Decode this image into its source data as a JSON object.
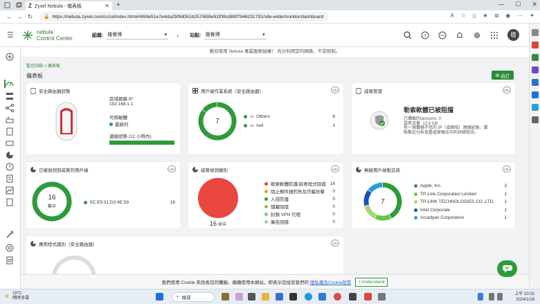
{
  "browser": {
    "tab_title": "Zyxel Nebula - 儀表板",
    "tab_favicon": "Z",
    "url": "https://nebula.zyxel.com/cc/ui/index.html#/659e51e7e4da25f9d051b257/659e51f09cd88f7946231791/site-wide/monitor/dashboard"
  },
  "header": {
    "logo_line1": "nebula",
    "logo_line2": "Control Center",
    "org_label": "組織:",
    "org_value": "雅餐博",
    "site_label": "站點:",
    "site_value": "雅餐博",
    "avatar_initial": "穩"
  },
  "banner": "歡迎使用 Nebula 專業服務授權！ 充分利用您的網路，不受限制。",
  "breadcrumb": "監控站點 > 儀表板",
  "page_title": "儀表板",
  "customize_label": "自訂",
  "gateway_card": {
    "title": "安全路由器狀態",
    "ip_label": "區域網路 IP",
    "ip_value": "192.168.1.1",
    "fw_label": "可用韌體",
    "fw_value": "最新的",
    "conn_label": "連線狀態 (12 小時內)"
  },
  "os_card": {
    "title": "用戶端作業系統（安全路由器）",
    "badge": "24h",
    "total": "7",
    "items": [
      {
        "label": "Others",
        "value": "6",
        "color": "#2e9b3a"
      },
      {
        "label": "null",
        "value": "1",
        "color": "#2e9b3a"
      }
    ]
  },
  "threat_card": {
    "title": "威脅管理",
    "badge": "24h",
    "headline": "勒索軟體已被阻擋",
    "line1": "已攔截的sessions: 0",
    "line2": "惡意流量: 12.8 GB",
    "desc": "有一個儀器不信的 IP（或網域）連線紀錄，請點擊記分析查看威脅報告中的詳細資訊。"
  },
  "clients_card": {
    "title": "已被偵測到威脅的用戶端",
    "badge": "24h",
    "total": "16",
    "unit": "擊中",
    "items": [
      {
        "label": "5C:E9:31:D2:4E:59",
        "value": "16",
        "color": "#2e9b3a"
      }
    ]
  },
  "category_card": {
    "title": "威脅偵測類別",
    "badge": "24h",
    "total": "16",
    "unit": "命中",
    "items": [
      {
        "label": "勒索軟體防護/惡意程式阻擋",
        "value": "16",
        "color": "#e8463f"
      },
      {
        "label": "阻止郵件鏈釣魚及詐騙攻擊",
        "value": "0",
        "color": "#f0a020"
      },
      {
        "label": "入侵防護",
        "value": "0",
        "color": "#2e9b3a"
      },
      {
        "label": "隱藏阻擋",
        "value": "0",
        "color": "#8bc34a"
      },
      {
        "label": "封鎖 VPN 代理",
        "value": "0",
        "color": "#7cc88a"
      },
      {
        "label": "廣告阻擋",
        "value": "0",
        "color": "#9bd5a0"
      }
    ]
  },
  "vendor_card": {
    "title": "無線用戶端製造商",
    "badge": "24h",
    "total": "7",
    "items": [
      {
        "label": "Apple, Inc.",
        "value": "3",
        "color": "#2e9b3a"
      },
      {
        "label": "TP-Link Corporation Limited",
        "value": "1",
        "color": "#6cc24a"
      },
      {
        "label": "TP-LINK TECHNOLOGIES CO.,LTD.",
        "value": "1",
        "color": "#a5d67a"
      },
      {
        "label": "Intel Corporate",
        "value": "1",
        "color": "#1e4fb8"
      },
      {
        "label": "Arcadyan Corporation",
        "value": "1",
        "color": "#2a9be0"
      }
    ]
  },
  "app_card": {
    "title": "應用程式識別（安全路由器）",
    "badge": "24h"
  },
  "cookie": {
    "text": "我們使用 Cookie 來改善您的體驗。繼續使用本網站，即表示您接受我們的",
    "link": "隱私權及Cookie政策",
    "button": "I Understand"
  },
  "taskbar": {
    "temp": "19°C",
    "weather": "晴時多雲",
    "search": "搜尋",
    "time": "上午 10:02",
    "date": "2024/1/18"
  }
}
